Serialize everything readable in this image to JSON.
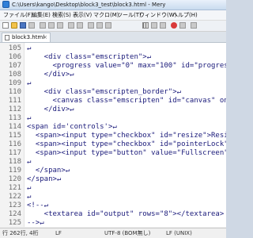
{
  "window": {
    "title": "C:\\Users\\kango\\Desktop\\block3_test\\block3.html - Mery"
  },
  "menu": [
    {
      "label": "ファイル(F)"
    },
    {
      "label": "編集(E)"
    },
    {
      "label": "検索(S)"
    },
    {
      "label": "表示(V)"
    },
    {
      "label": "マクロ(M)"
    },
    {
      "label": "ツール(T)"
    },
    {
      "label": "ウィンドウ(W)"
    },
    {
      "label": "ヘルプ(H)"
    }
  ],
  "tab": {
    "label": "block3.html",
    "close": "×"
  },
  "editor": {
    "line_numbers": [
      "105",
      "106",
      "107",
      "108",
      "109",
      "110",
      "111",
      "112",
      "113",
      "114",
      "115",
      "116",
      "117",
      "118",
      "119",
      "120",
      "121",
      "122",
      "123",
      "124",
      "125"
    ],
    "lines": [
      "↵",
      "    <div class=\"emscripten\">↵",
      "      <progress value=\"0\" max=\"100\" id=\"progress",
      "    </div>↵",
      "↵",
      "    <div class=\"emscripten_border\">↵",
      "      <canvas class=\"emscripten\" id=\"canvas\" onc",
      "    </div>↵",
      "↵",
      "<span id='controls'>↵",
      "  <span><input type=\"checkbox\" id=\"resize\">Resiz",
      "  <span><input type=\"checkbox\" id=\"pointerLock\"",
      "  <span><input type=\"button\" value=\"Fullscreen\"",
      "↵",
      "  </span>↵",
      "</span>↵",
      "↵",
      "↵",
      "<!--↵",
      "    <textarea id=\"output\" rows=\"8\"></textarea>",
      "-->↵"
    ]
  },
  "status": {
    "position": "行 262行, 4桁",
    "newline": "LF",
    "encoding": "UTF-8 (BOM無し)",
    "newline_type": "LF (UNIX)"
  },
  "colors": {
    "tag": "#1a1a7a",
    "string": "#7d2e9e",
    "newline_mark": "#0a6fb5"
  }
}
